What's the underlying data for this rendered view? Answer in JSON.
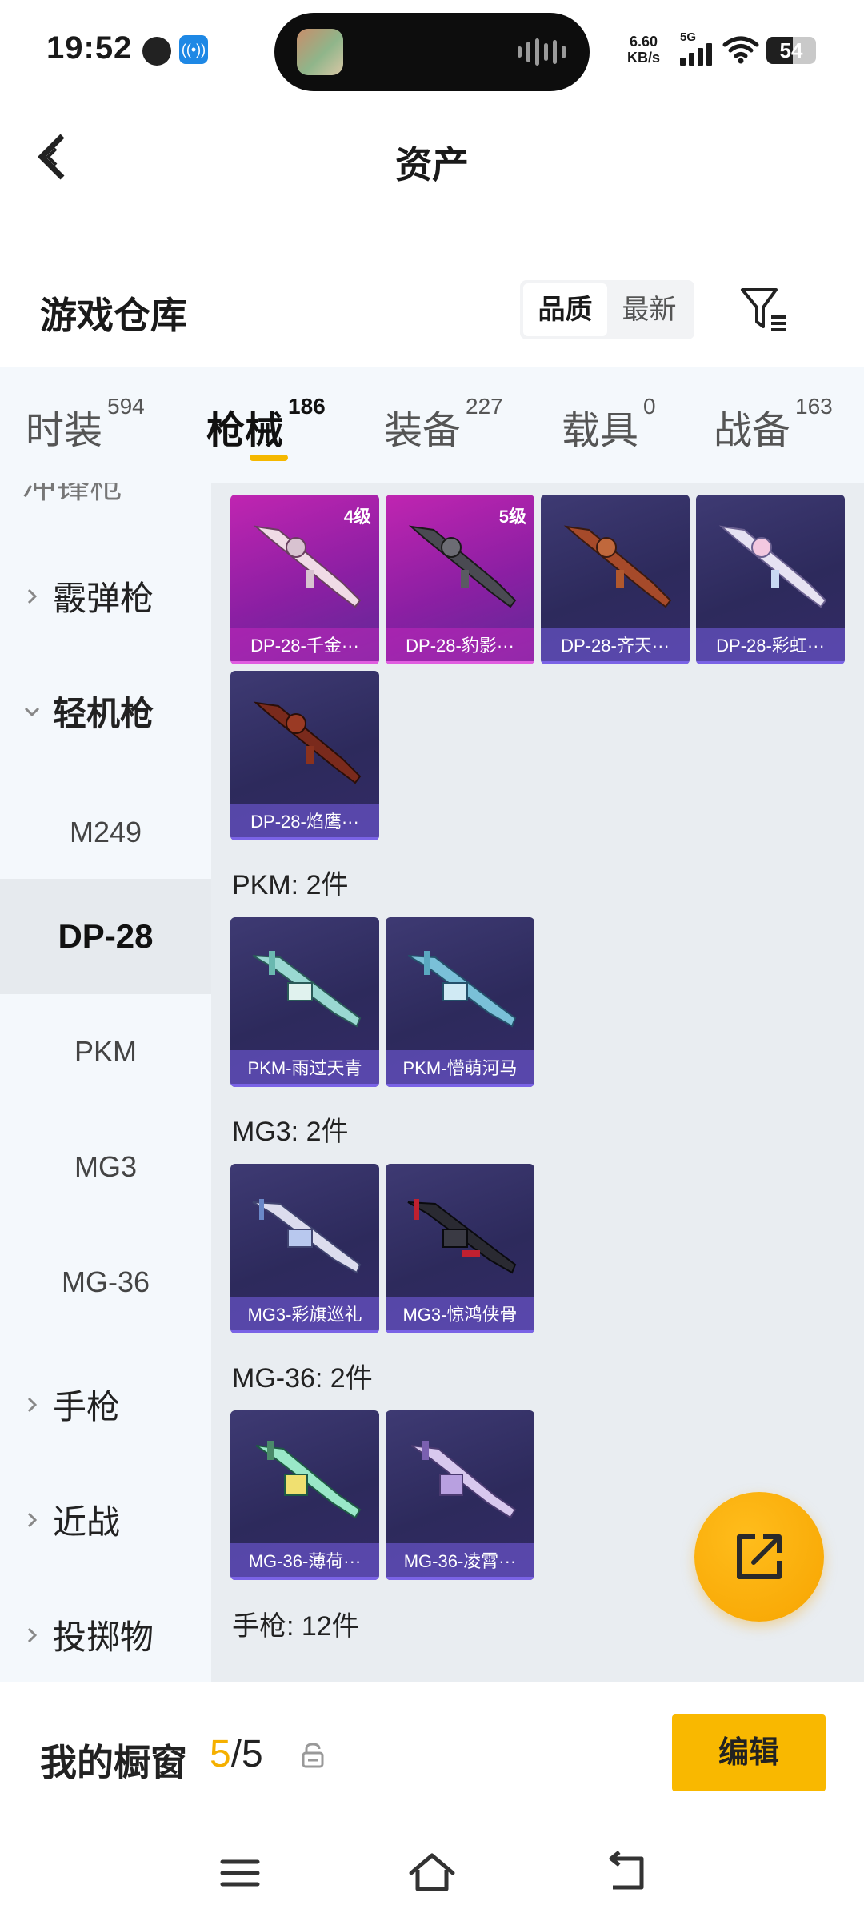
{
  "status_bar": {
    "time": "19:52",
    "network_speed_value": "6.60",
    "network_speed_unit": "KB/s",
    "network_type": "5G",
    "battery": "54",
    "battery_level": 0.54
  },
  "header": {
    "title": "资产",
    "back_icon": "chevron-left-icon"
  },
  "section": {
    "title": "游戏仓库",
    "sort_options": [
      "品质",
      "最新"
    ],
    "active_sort": "品质",
    "filter_icon": "filter-icon"
  },
  "category_tabs": [
    {
      "label": "时装",
      "count": "594"
    },
    {
      "label": "枪械",
      "count": "186",
      "active": true
    },
    {
      "label": "装备",
      "count": "227"
    },
    {
      "label": "载具",
      "count": "0"
    },
    {
      "label": "战备",
      "count": "163"
    }
  ],
  "sidebar": {
    "cut_item": "冲锋枪",
    "groups": [
      {
        "label": "霰弹枪",
        "expanded": false
      },
      {
        "label": "轻机枪",
        "expanded": true
      },
      {
        "label": "手枪",
        "expanded": false
      },
      {
        "label": "近战",
        "expanded": false
      },
      {
        "label": "投掷物",
        "expanded": false
      }
    ],
    "subitems": [
      "M249",
      "DP-28",
      "PKM",
      "MG3",
      "MG-36"
    ],
    "active_subitem": "DP-28"
  },
  "content": {
    "dp28_cards": [
      {
        "name": "DP-28-千金···",
        "level": "4级",
        "rarity": "pink"
      },
      {
        "name": "DP-28-豹影···",
        "level": "5级",
        "rarity": "pink"
      },
      {
        "name": "DP-28-齐天···",
        "level": "",
        "rarity": "purple"
      },
      {
        "name": "DP-28-彩虹···",
        "level": "",
        "rarity": "purple"
      },
      {
        "name": "DP-28-焰鹰···",
        "level": "",
        "rarity": "purple"
      }
    ],
    "pkm_header": "PKM: 2件",
    "pkm_cards": [
      {
        "name": "PKM-雨过天青"
      },
      {
        "name": "PKM-懵萌河马"
      }
    ],
    "mg3_header": "MG3: 2件",
    "mg3_cards": [
      {
        "name": "MG3-彩旗巡礼"
      },
      {
        "name": "MG3-惊鸿侠骨"
      }
    ],
    "mg36_header": "MG-36: 2件",
    "mg36_cards": [
      {
        "name": "MG-36-薄荷···"
      },
      {
        "name": "MG-36-凌霄···"
      }
    ],
    "pistol_header": "手枪: 12件"
  },
  "fab": {
    "icon": "share-icon"
  },
  "bottom": {
    "window_label": "我的橱窗",
    "window_current": "5",
    "window_total": "/5",
    "edit_label": "编辑"
  },
  "nav": {
    "menu_icon": "menu-icon",
    "home_icon": "home-icon",
    "back_icon": "back-icon"
  },
  "colors": {
    "accent": "#f9b800",
    "purple_card": "#2d2a5c",
    "pink_card": "#b523ad",
    "sidebar_bg": "#f4f8fc",
    "content_bg": "#e9edf1"
  }
}
